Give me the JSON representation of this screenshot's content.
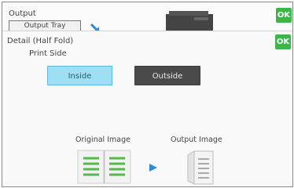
{
  "header": {
    "title": "Output",
    "tab_label": "Output Tray",
    "ok_label": "OK"
  },
  "dialog": {
    "title": "Detail (Half Fold)",
    "ok_label": "OK",
    "print_side_label": "Print Side",
    "options": [
      {
        "label": "Inside",
        "selected": true
      },
      {
        "label": "Outside",
        "selected": false
      }
    ],
    "original_image_label": "Original Image",
    "output_image_label": "Output Image"
  },
  "colors": {
    "ok_green": "#3cb54a",
    "selected_blue": "#9fdff4",
    "unselected_dark": "#4a4a4a",
    "arrow_blue": "#2e8bd6",
    "page_lines_green": "#55b84a"
  },
  "icons": {
    "tray_arrow": "tray-arrow-icon",
    "machine": "machine-icon",
    "original_image": "open-book-icon",
    "play": "play-arrow-icon",
    "output_image": "folded-page-icon"
  }
}
